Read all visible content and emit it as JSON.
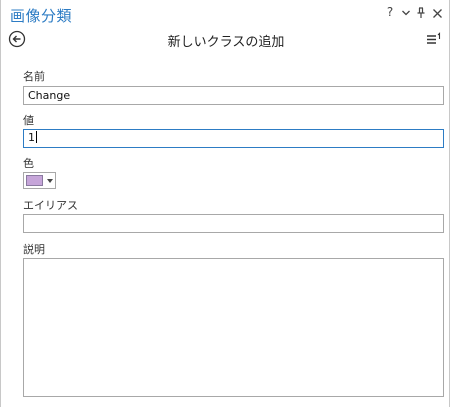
{
  "window": {
    "title": "画像分類",
    "help_label": "?"
  },
  "header": {
    "title": "新しいクラスの追加"
  },
  "form": {
    "name": {
      "label": "名前",
      "value": "Change"
    },
    "value": {
      "label": "値",
      "value": "1"
    },
    "color": {
      "label": "色",
      "swatch": "#c6a5d9"
    },
    "alias": {
      "label": "エイリアス",
      "value": ""
    },
    "description": {
      "label": "説明",
      "value": ""
    }
  },
  "colors": {
    "accent": "#2d7cc4",
    "border": "#a8a8a8"
  }
}
